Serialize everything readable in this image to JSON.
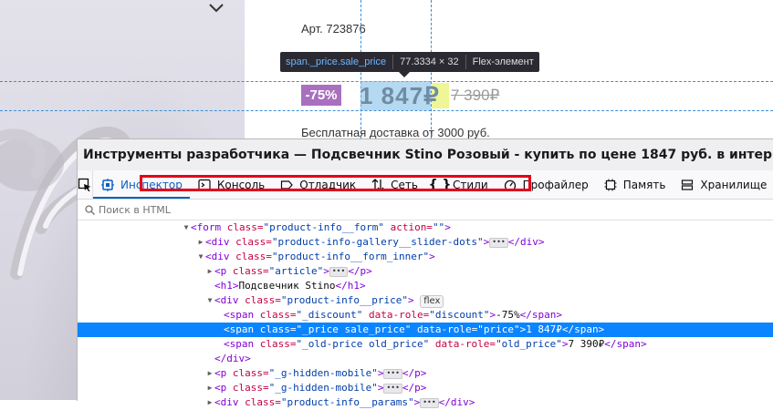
{
  "page": {
    "sku": "Арт. 723876",
    "discount": "-75%",
    "price": "1 847₽",
    "old_price": "7 390₽",
    "delivery": "Бесплатная доставка от 3000 руб.",
    "highlight_tooltip": {
      "selector": "span._price.sale_price",
      "size": "77.3334 × 32",
      "kind": "Flex-элемент"
    }
  },
  "devtools": {
    "title": "Инструменты разработчика — Подсвечник Stino Розовый - купить по цене 1847 руб. в интернет-магазине СС",
    "tabs": [
      {
        "label": "Инспектор",
        "icon": "inspector-icon",
        "active": true
      },
      {
        "label": "Консоль",
        "icon": "console-icon"
      },
      {
        "label": "Отладчик",
        "icon": "debugger-icon"
      },
      {
        "label": "Сеть",
        "icon": "network-icon"
      },
      {
        "label": "Стили",
        "icon": "braces-icon"
      },
      {
        "label": "Профайлер",
        "icon": "performance-icon"
      },
      {
        "label": "Память",
        "icon": "memory-icon"
      },
      {
        "label": "Хранилище",
        "icon": "storage-icon"
      }
    ],
    "search_placeholder": "Поиск в HTML",
    "tree": {
      "r0": {
        "tag_open": "<form ",
        "attr1": "class=",
        "val1": "\"product-info__form\"",
        "attr2": " action=",
        "val2": "\"\"",
        "tag_close": ">"
      },
      "r1": {
        "tag_open": "<div ",
        "attr1": "class=",
        "val1": "\"product-info-gallery__slider-dots\"",
        "tag_close": ">",
        "tag_end": "</div>"
      },
      "r2": {
        "tag_open": "<div ",
        "attr1": "class=",
        "val1": "\"product-info__form_inner\"",
        "tag_close": ">"
      },
      "r3": {
        "tag_open": "<p ",
        "attr1": "class=",
        "val1": "\"article\"",
        "tag_close": ">",
        "tag_end": "</p>"
      },
      "r4": {
        "tag_open": "<h1>",
        "text": "Подсвечник Stino",
        "tag_end": "</h1>"
      },
      "r5": {
        "tag_open": "<div ",
        "attr1": "class=",
        "val1": "\"product-info__price\"",
        "tag_close": ">",
        "badge": "flex"
      },
      "r6": {
        "tag_open": "<span ",
        "attr1": "class=",
        "val1": "\"_discount\"",
        "attr2": " data-role=",
        "val2": "\"discount\"",
        "tag_close": ">",
        "text": "-75%",
        "tag_end": "</span>"
      },
      "r7": {
        "tag_open": "<span ",
        "attr1": "class=",
        "val1": "\"_price sale_price\"",
        "attr2": " data-role=",
        "val2": "\"price\"",
        "tag_close": ">",
        "text": "1 847₽",
        "tag_end": "</span>"
      },
      "r8": {
        "tag_open": "<span ",
        "attr1": "class=",
        "val1": "\"_old-price old_price\"",
        "attr2": " data-role=",
        "val2": "\"old_price\"",
        "tag_close": ">",
        "text": "7 390₽",
        "tag_end": "</span>"
      },
      "r9": {
        "tag_end": "</div>"
      },
      "r10": {
        "tag_open": "<p ",
        "attr1": "class=",
        "val1": "\"_g-hidden-mobile\"",
        "tag_close": ">",
        "tag_end": "</p>"
      },
      "r11": {
        "tag_open": "<p ",
        "attr1": "class=",
        "val1": "\"_g-hidden-mobile\"",
        "tag_close": ">",
        "tag_end": "</p>"
      },
      "r12": {
        "tag_open": "<div ",
        "attr1": "class=",
        "val1": "\"product-info__params\"",
        "tag_close": ">",
        "tag_end": "</div>"
      }
    }
  }
}
